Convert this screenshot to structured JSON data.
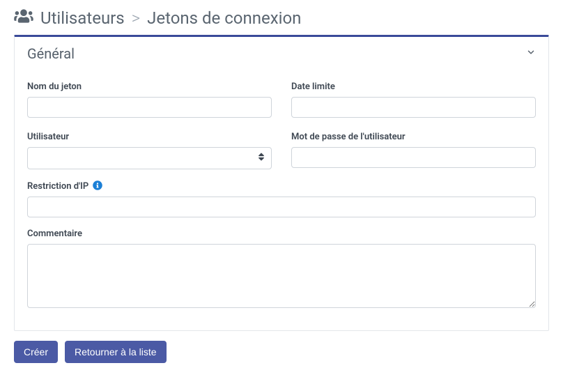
{
  "header": {
    "section": "Utilisateurs",
    "subsection": "Jetons de connexion"
  },
  "panel": {
    "title": "Général"
  },
  "fields": {
    "token_name": {
      "label": "Nom du jeton",
      "value": ""
    },
    "deadline": {
      "label": "Date limite",
      "value": ""
    },
    "user": {
      "label": "Utilisateur",
      "selected": ""
    },
    "password": {
      "label": "Mot de passe de l'utilisateur",
      "value": ""
    },
    "ip_restrict": {
      "label": "Restriction d'IP",
      "value": ""
    },
    "comment": {
      "label": "Commentaire",
      "value": ""
    }
  },
  "buttons": {
    "create": "Créer",
    "back": "Retourner à la liste"
  }
}
